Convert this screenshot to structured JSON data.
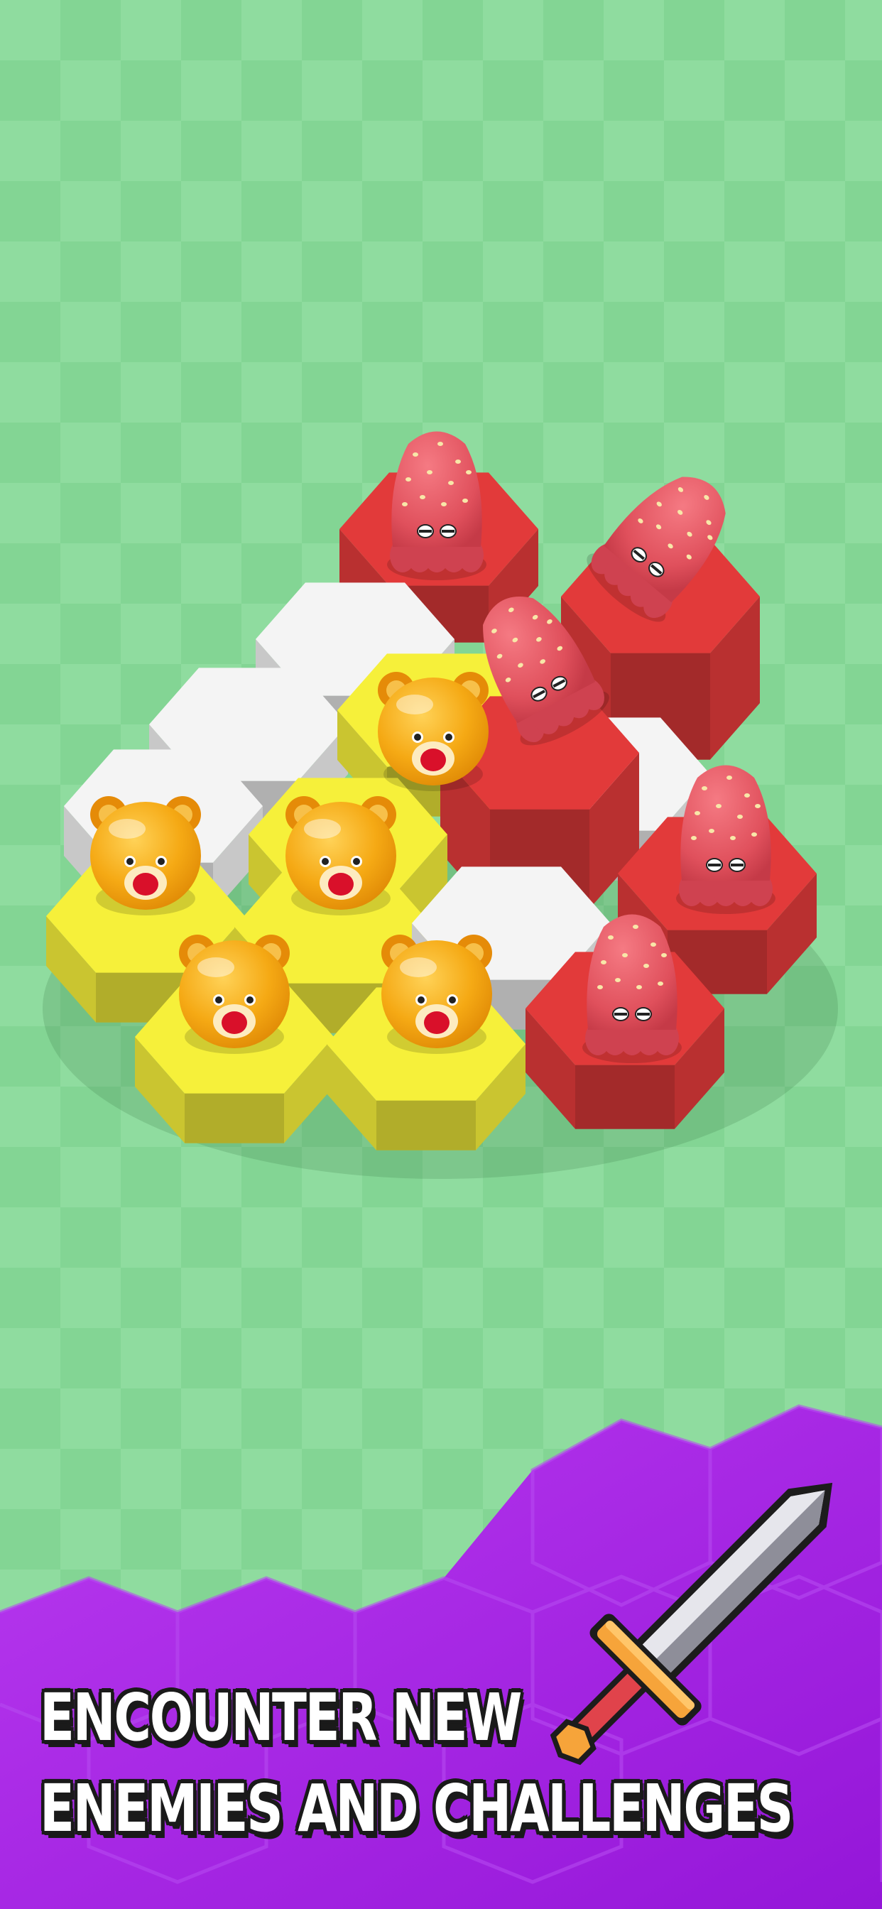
{
  "caption": {
    "line1": "ENCOUNTER NEW",
    "line2": "ENEMIES AND CHALLENGES"
  },
  "colors": {
    "grass_light": "#8fdc9f",
    "grass_dark": "#80d391",
    "tile_white": "#f4f4f4",
    "tile_yellow": "#f6f03a",
    "tile_red": "#e23a3a",
    "bear_gold": "#f6ab1c",
    "octopus_pink": "#e2505b",
    "banner_purple": "#a31fe0"
  },
  "icons": {
    "bear": "bear-icon",
    "octopus": "octopus-icon",
    "sword": "sword-icon"
  }
}
